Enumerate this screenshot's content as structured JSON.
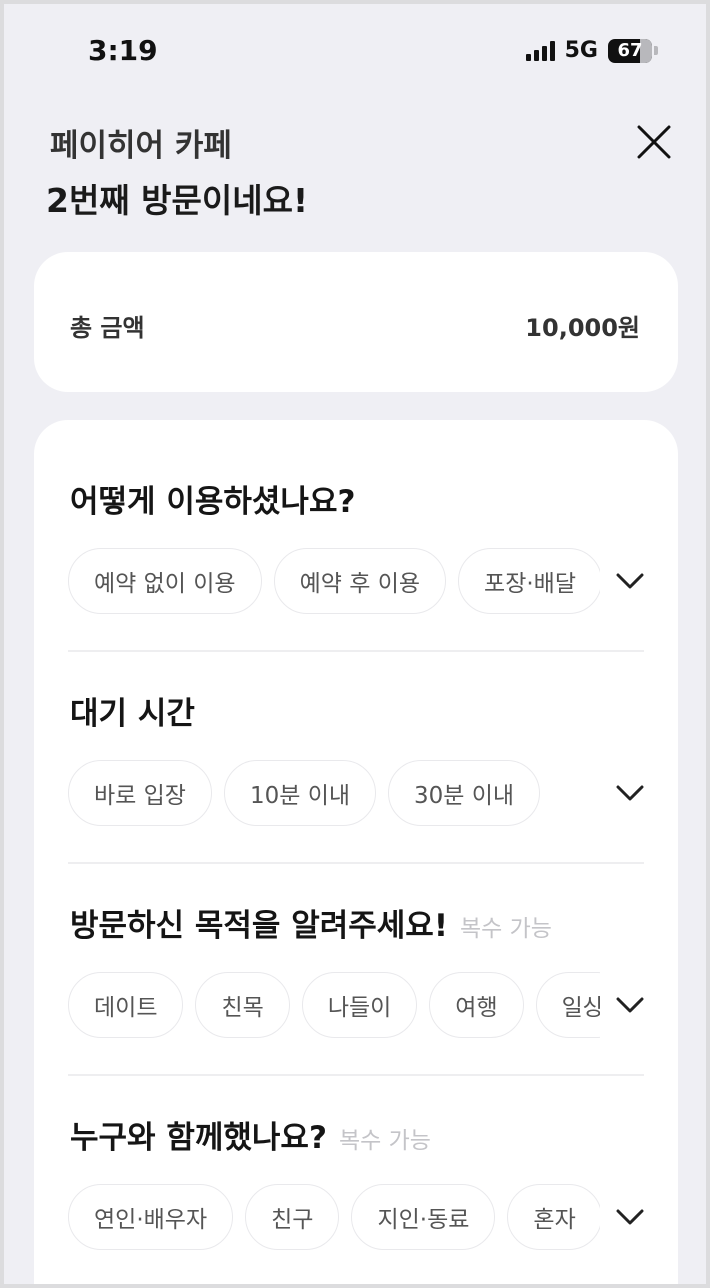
{
  "status_bar": {
    "time": "3:19",
    "network": "5G",
    "battery": "67"
  },
  "header": {
    "store_name": "페이히어 카페",
    "visit_message": "2번째 방문이네요!",
    "close_icon": "close-icon"
  },
  "total": {
    "label": "총 금액",
    "value": "10,000원"
  },
  "sections": [
    {
      "title": "어떻게 이용하셨나요?",
      "hint": "",
      "options": [
        "예약 없이 이용",
        "예약 후 이용",
        "포장·배달"
      ]
    },
    {
      "title": "대기 시간",
      "hint": "",
      "options": [
        "바로 입장",
        "10분 이내",
        "30분 이내"
      ]
    },
    {
      "title": "방문하신 목적을 알려주세요!",
      "hint": "복수 가능",
      "options": [
        "데이트",
        "친목",
        "나들이",
        "여행",
        "일상"
      ]
    },
    {
      "title": "누구와 함께했나요?",
      "hint": "복수 가능",
      "options": [
        "연인·배우자",
        "친구",
        "지인·동료",
        "혼자"
      ]
    }
  ],
  "colors": {
    "background": "#efeff4",
    "card": "#ffffff",
    "chip_border": "#e9e9ec",
    "hint": "#c4c4c8"
  }
}
